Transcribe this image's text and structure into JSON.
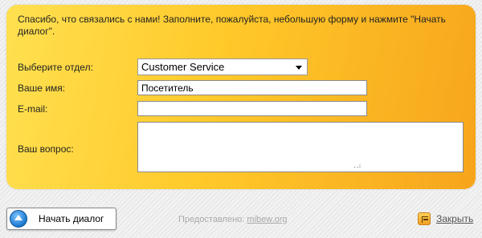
{
  "intro_text": "Спасибо, что связались с нами! Заполните, пожалуйста, небольшую форму и нажмите \"Начать диалог\".",
  "form": {
    "department_label": "Выберите отдел:",
    "department_value": "Customer Service",
    "name_label": "Ваше имя:",
    "name_value": "Посетитель",
    "email_label": "E-mail:",
    "email_value": "",
    "question_label": "Ваш вопрос:",
    "question_value": ""
  },
  "footer": {
    "start_button_label": "Начать диалог",
    "powered_prefix": "Предоставлено: ",
    "powered_link": "mibew.org",
    "close_label": "Закрыть"
  },
  "colors": {
    "panel_start": "#ffe050",
    "panel_end": "#f7a51c",
    "button_icon": "#1b78d0"
  },
  "icons": {
    "start": "arrow-up-circle-icon",
    "close": "exit-door-icon",
    "select": "chevron-down-icon"
  }
}
